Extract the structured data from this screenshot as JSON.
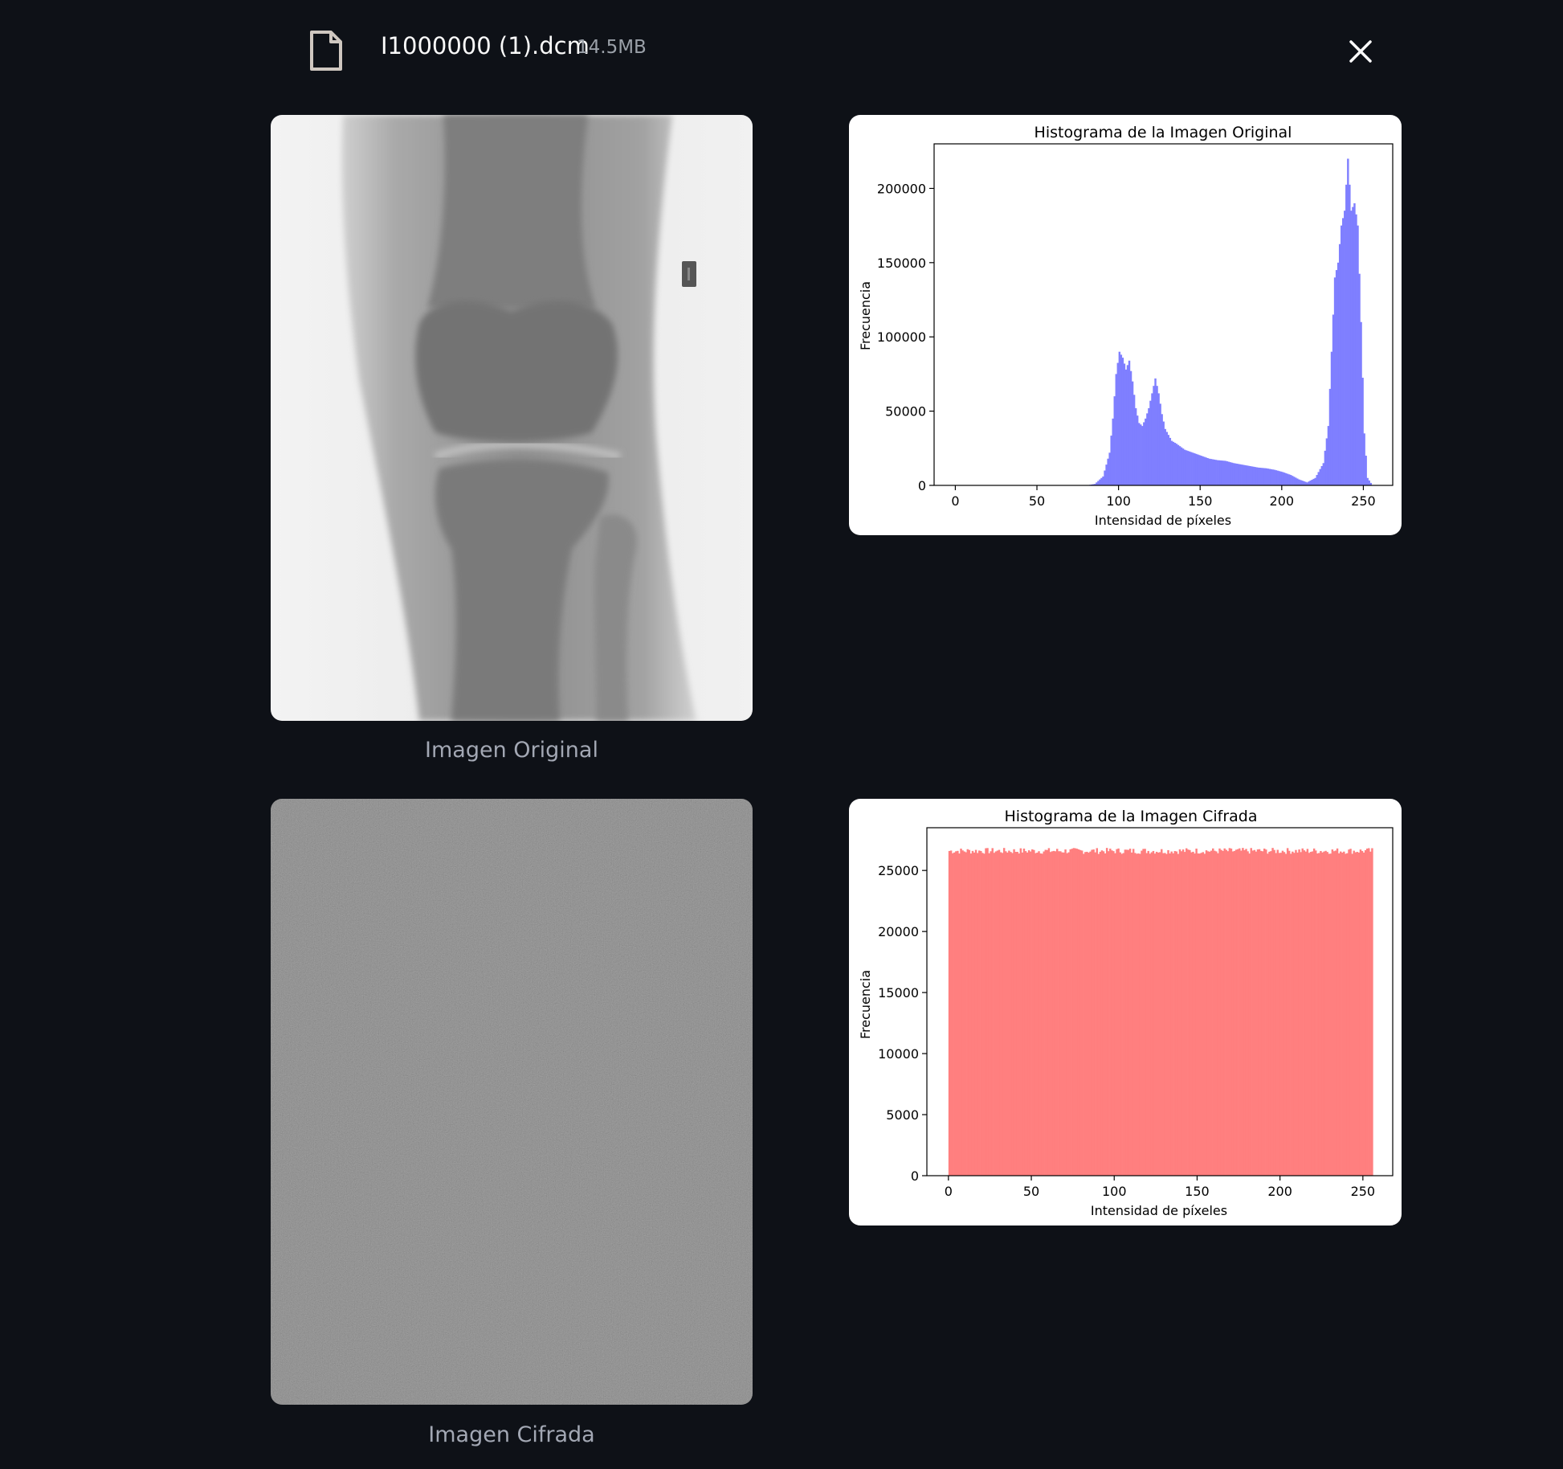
{
  "file": {
    "name": "I1000000 (1).dcm",
    "size": "14.5MB",
    "icon": "file-icon",
    "close_icon": "close-icon"
  },
  "images": [
    {
      "caption": "Imagen Original"
    },
    {
      "caption": "Imagen Cifrada"
    }
  ],
  "chart_data": [
    {
      "type": "bar",
      "title": "Histograma de la Imagen Original",
      "xlabel": "Intensidad de píxeles",
      "ylabel": "Frecuencia",
      "color": "#7f7fff",
      "xlim": [
        -13,
        268
      ],
      "ylim": [
        0,
        230000
      ],
      "xticks": [
        0,
        50,
        100,
        150,
        200,
        250
      ],
      "yticks": [
        0,
        50000,
        100000,
        150000,
        200000
      ],
      "x": [
        80,
        85,
        90,
        94,
        96,
        98,
        100,
        102,
        104,
        106,
        108,
        110,
        112,
        114,
        116,
        118,
        120,
        122,
        124,
        126,
        128,
        130,
        132,
        135,
        140,
        145,
        150,
        155,
        160,
        165,
        170,
        175,
        180,
        185,
        190,
        195,
        200,
        205,
        210,
        215,
        220,
        225,
        228,
        230,
        232,
        234,
        236,
        238,
        240,
        242,
        244,
        246,
        248,
        250,
        252,
        255
      ],
      "values": [
        0,
        1000,
        6000,
        22000,
        45000,
        75000,
        90000,
        86000,
        78000,
        84000,
        70000,
        52000,
        42000,
        40000,
        45000,
        52000,
        62000,
        72000,
        62000,
        48000,
        38000,
        34000,
        30000,
        28000,
        24000,
        22000,
        20000,
        18000,
        17000,
        16500,
        15000,
        14000,
        13000,
        12000,
        11500,
        10500,
        9000,
        7000,
        4000,
        2000,
        5000,
        15000,
        40000,
        90000,
        140000,
        150000,
        175000,
        185000,
        220000,
        185000,
        190000,
        175000,
        110000,
        35000,
        5000,
        0
      ]
    },
    {
      "type": "bar",
      "title": "Histograma de la Imagen Cifrada",
      "xlabel": "Intensidad de píxeles",
      "ylabel": "Frecuencia",
      "color": "#ff7f7f",
      "xlim": [
        -13,
        268
      ],
      "ylim": [
        0,
        28500
      ],
      "xticks": [
        0,
        50,
        100,
        150,
        200,
        250
      ],
      "yticks": [
        0,
        5000,
        10000,
        15000,
        20000,
        25000
      ],
      "x_range": [
        0,
        255
      ],
      "base_value": 26600,
      "variation": 250
    }
  ]
}
